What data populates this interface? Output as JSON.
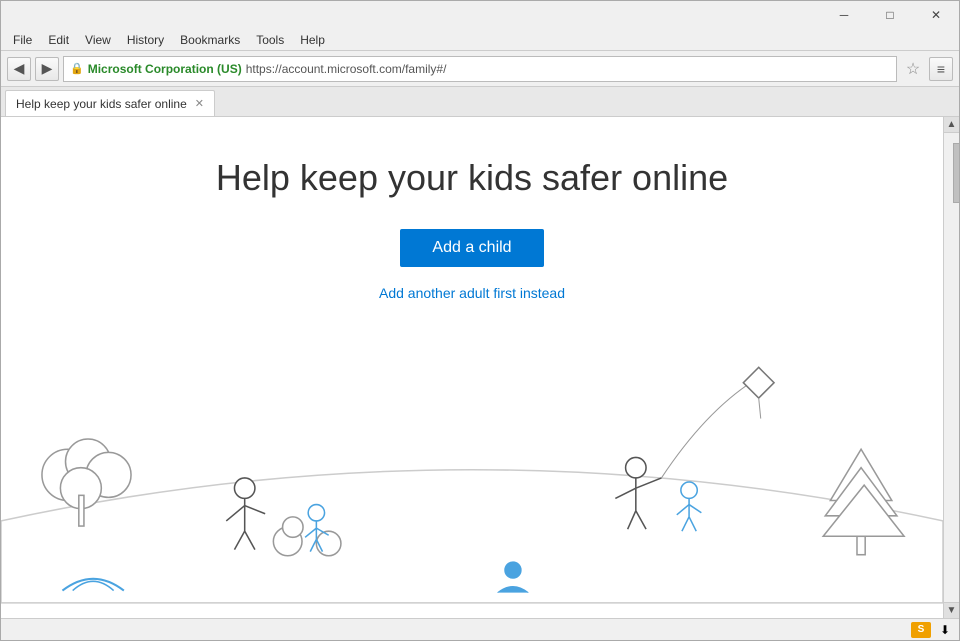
{
  "browser": {
    "menu": {
      "items": [
        "File",
        "Edit",
        "View",
        "History",
        "Bookmarks",
        "Tools",
        "Help"
      ]
    },
    "nav": {
      "back_label": "◀",
      "forward_label": "▶",
      "lock_label": "🔒",
      "site_name": "Microsoft Corporation (US)",
      "url": "https://account.microsoft.com/family#/",
      "star_label": "☆",
      "menu_label": "≡"
    },
    "tab": {
      "title": "Help keep your kids safer online",
      "close_label": "✕"
    },
    "window_controls": {
      "minimize": "─",
      "maximize": "□",
      "close": "✕"
    }
  },
  "page": {
    "title": "Help keep your kids safer online",
    "add_child_button": "Add a child",
    "add_adult_link": "Add another adult first instead"
  },
  "status_bar": {
    "icon1": "S",
    "icon2": "⬇"
  }
}
